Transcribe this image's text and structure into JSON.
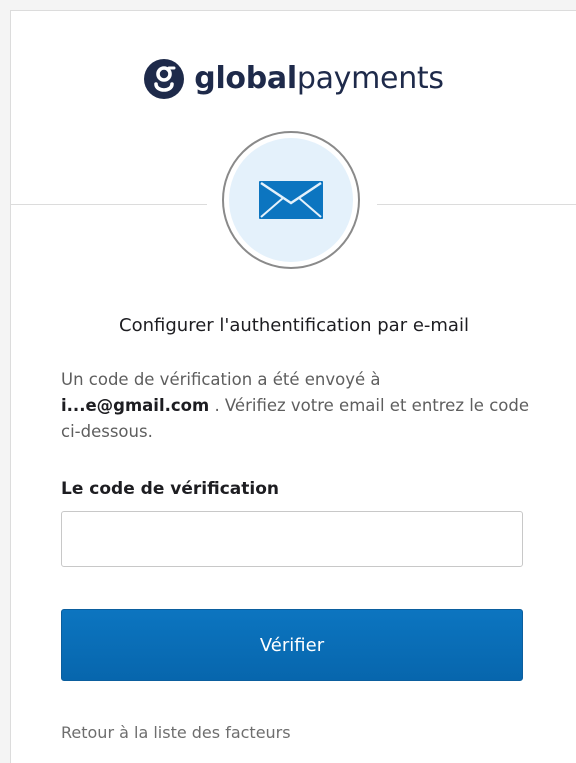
{
  "brand": {
    "name_bold": "global",
    "name_light": "payments",
    "logo_icon": "globalpayments-g-logo",
    "color": "#1e2a4a"
  },
  "factor_icon": "envelope-icon",
  "heading": "Configurer l'authentification par e-mail",
  "description": {
    "line_before": "Un code de vérification a été envoyé à",
    "email": "i...e@gmail.com",
    "line_after": ". Vérifiez votre email et entrez le code ci-dessous."
  },
  "verification": {
    "label": "Le code de vérification",
    "value": "",
    "placeholder": ""
  },
  "verify_button": {
    "label": "Vérifier",
    "color": "#0c75c0"
  },
  "back_link": "Retour à la liste des facteurs"
}
